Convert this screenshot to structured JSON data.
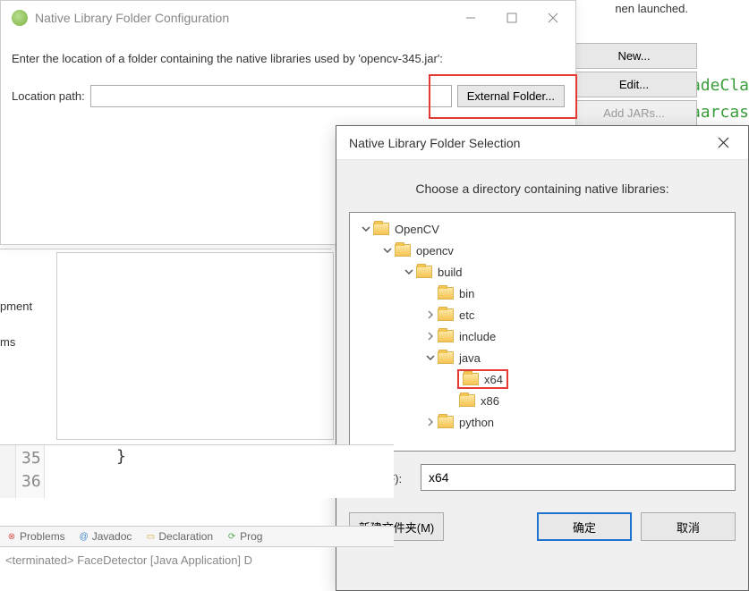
{
  "bg": {
    "launched_fragment": "nen launched.",
    "code_fragment1": "adeCla",
    "code_fragment2": "aarcas",
    "sidebar_items": [
      "pment",
      "ms"
    ]
  },
  "side_buttons": {
    "new": "New...",
    "edit": "Edit...",
    "add_jars": "Add JARs..."
  },
  "dialog1": {
    "title": "Native Library Folder Configuration",
    "instruction": "Enter the location of a folder containing the native libraries used by 'opencv-345.jar':",
    "label": "Location path:",
    "value": "",
    "ext_button": "External Folder..."
  },
  "dialog2": {
    "title": "Native Library Folder Selection",
    "instruction": "Choose a directory containing native libraries:",
    "tree": [
      {
        "depth": 0,
        "expander": "v",
        "label": "OpenCV"
      },
      {
        "depth": 1,
        "expander": "v",
        "label": "opencv"
      },
      {
        "depth": 2,
        "expander": "v",
        "label": "build"
      },
      {
        "depth": 3,
        "expander": "",
        "label": "bin"
      },
      {
        "depth": 3,
        "expander": ">",
        "label": "etc"
      },
      {
        "depth": 3,
        "expander": ">",
        "label": "include"
      },
      {
        "depth": 3,
        "expander": "v",
        "label": "java"
      },
      {
        "depth": 4,
        "expander": "",
        "label": "x64",
        "selected": true
      },
      {
        "depth": 4,
        "expander": "",
        "label": "x86"
      },
      {
        "depth": 3,
        "expander": ">",
        "label": "python"
      }
    ],
    "folder_label": "文件夹(F):",
    "folder_value": "x64",
    "new_folder": "新建文件夹(M)",
    "ok": "确定",
    "cancel": "取消"
  },
  "code": {
    "lines": [
      "35",
      "36"
    ],
    "content35": "}"
  },
  "tabs": {
    "problems": "Problems",
    "javadoc": "Javadoc",
    "declaration": "Declaration",
    "progress": "Prog"
  },
  "console": {
    "line": "<terminated> FaceDetector [Java Application] D"
  }
}
